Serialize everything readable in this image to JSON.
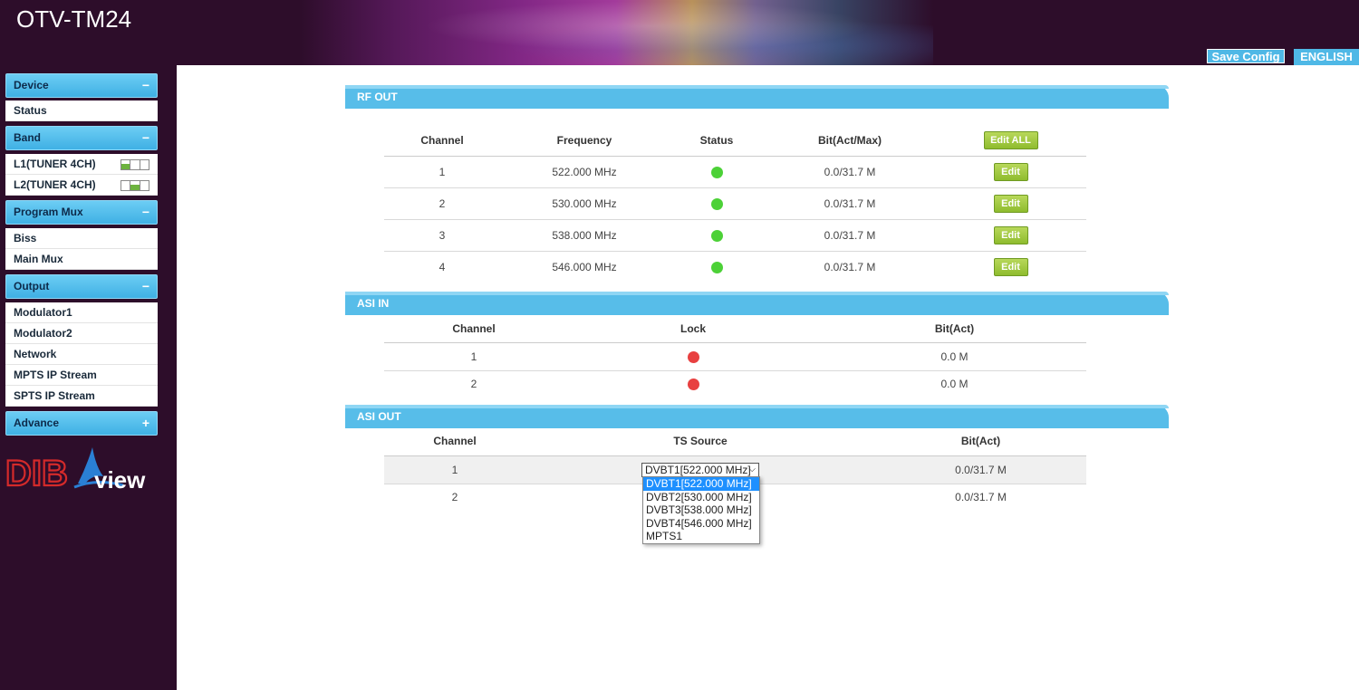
{
  "header": {
    "title": "OTV-TM24",
    "save_config": "Save Config",
    "language": "ENGLISH"
  },
  "sidebar": {
    "groups": [
      {
        "label": "Device",
        "toggle": "−",
        "items": [
          "Status"
        ]
      },
      {
        "label": "Band",
        "toggle": "−",
        "items": [
          "L1(TUNER 4CH)",
          "L2(TUNER 4CH)"
        ]
      },
      {
        "label": "Program Mux",
        "toggle": "−",
        "items": [
          "Biss",
          "Main Mux"
        ]
      },
      {
        "label": "Output",
        "toggle": "−",
        "items": [
          "Modulator1",
          "Modulator2",
          "Network",
          "MPTS IP Stream",
          "SPTS IP Stream"
        ]
      },
      {
        "label": "Advance",
        "toggle": "+",
        "items": []
      }
    ],
    "logo": {
      "text_dib": "DIB",
      "text_view": "view"
    }
  },
  "rf_out": {
    "title": "RF OUT",
    "headers": [
      "Channel",
      "Frequency",
      "Status",
      "Bit(Act/Max)"
    ],
    "edit_all_label": "Edit ALL",
    "edit_label": "Edit",
    "status_color": "#4cd137",
    "rows": [
      {
        "channel": "1",
        "frequency": "522.000 MHz",
        "bit": "0.0/31.7 M"
      },
      {
        "channel": "2",
        "frequency": "530.000 MHz",
        "bit": "0.0/31.7 M"
      },
      {
        "channel": "3",
        "frequency": "538.000 MHz",
        "bit": "0.0/31.7 M"
      },
      {
        "channel": "4",
        "frequency": "546.000 MHz",
        "bit": "0.0/31.7 M"
      }
    ]
  },
  "asi_in": {
    "title": "ASI IN",
    "headers": [
      "Channel",
      "Lock",
      "Bit(Act)"
    ],
    "lock_color": "#e84040",
    "rows": [
      {
        "channel": "1",
        "bit": "0.0 M"
      },
      {
        "channel": "2",
        "bit": "0.0 M"
      }
    ]
  },
  "asi_out": {
    "title": "ASI OUT",
    "headers": [
      "Channel",
      "TS Source",
      "Bit(Act)"
    ],
    "rows": [
      {
        "channel": "1",
        "source": "DVBT1[522.000 MHz]",
        "bit": "0.0/31.7 M"
      },
      {
        "channel": "2",
        "source": "",
        "bit": "0.0/31.7 M"
      }
    ],
    "dropdown_options": [
      "DVBT1[522.000 MHz]",
      "DVBT2[530.000 MHz]",
      "DVBT3[538.000 MHz]",
      "DVBT4[546.000 MHz]",
      "MPTS1"
    ],
    "selected_index": 0
  }
}
